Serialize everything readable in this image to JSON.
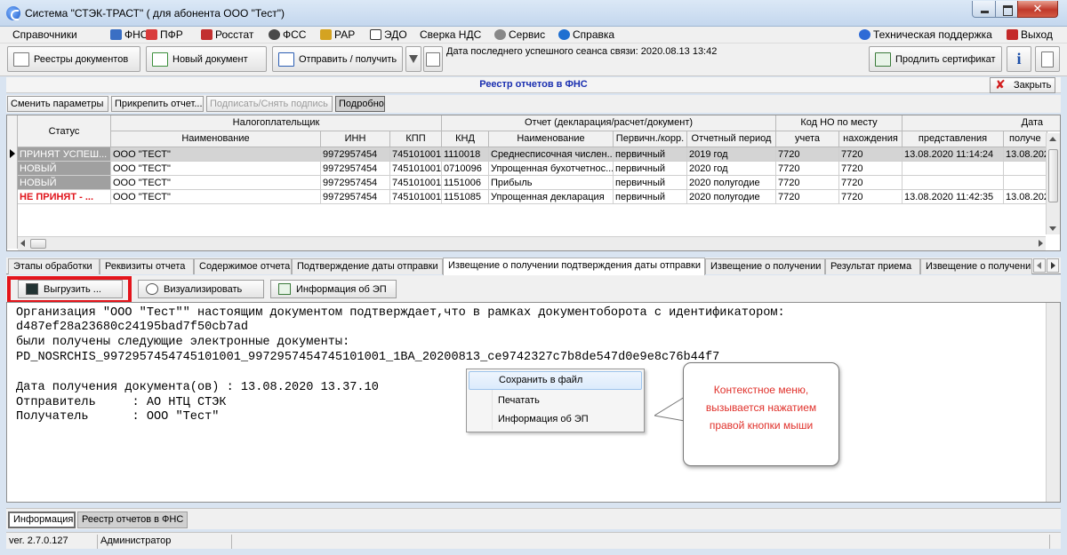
{
  "window": {
    "title": "Система \"СТЭК-ТРАСТ\" ( для абонента ООО \"Тест\")"
  },
  "menu": {
    "items": [
      "Справочники",
      "ФНС",
      "ПФР",
      "Росстат",
      "ФСС",
      "РАР",
      "ЭДО",
      "Сверка НДС",
      "Сервис",
      "Справка"
    ],
    "support": "Техническая поддержка",
    "exit": "Выход"
  },
  "toolbar": {
    "registry": "Реестры документов",
    "new_doc": "Новый документ",
    "send_receive": "Отправить / получить",
    "session": "Дата последнего успешного сеанса связи: 2020.08.13 13:42",
    "renew_cert": "Продлить сертификат"
  },
  "registry": {
    "title": "Реестр отчетов в ФНС",
    "close": "Закрыть"
  },
  "small_buttons": [
    "Сменить параметры",
    "Прикрепить отчет...",
    "Подписать/Снять подпись",
    "Подробно"
  ],
  "grid": {
    "group_headers": [
      "Налогоплательщик",
      "Отчет (декларация/расчет/документ)",
      "Код НО по месту",
      "Дата"
    ],
    "status_header": "Статус",
    "columns": [
      "Наименование",
      "ИНН",
      "КПП",
      "КНД",
      "Наименование",
      "Первичн./корр.",
      "Отчетный период",
      "учета",
      "нахождения",
      "представления",
      "получе"
    ],
    "rows": [
      {
        "status": "ПРИНЯТ УСПЕШ...",
        "cells": [
          "ООО \"ТЕСТ\"",
          "9972957454",
          "745101001",
          "1110018",
          "Среднесписочная числен...",
          "первичный",
          "2019 год",
          "7720",
          "7720",
          "13.08.2020 11:14:24",
          "13.08.202"
        ]
      },
      {
        "status": "НОВЫЙ",
        "cells": [
          "ООО \"ТЕСТ\"",
          "9972957454",
          "745101001",
          "0710096",
          "Упрощенная бухотчетнос...",
          "первичный",
          "2020 год",
          "7720",
          "7720",
          "",
          ""
        ]
      },
      {
        "status": "НОВЫЙ",
        "cells": [
          "ООО \"ТЕСТ\"",
          "9972957454",
          "745101001",
          "1151006",
          "Прибыль",
          "первичный",
          "2020 полугодие",
          "7720",
          "7720",
          "",
          ""
        ]
      },
      {
        "status": "НЕ ПРИНЯТ - ...",
        "cells": [
          "ООО \"ТЕСТ\"",
          "9972957454",
          "745101001",
          "1151085",
          "Упрощенная декларация",
          "первичный",
          "2020 полугодие",
          "7720",
          "7720",
          "13.08.2020 11:42:35",
          "13.08.202"
        ]
      }
    ]
  },
  "tabs": [
    "Этапы обработки",
    "Реквизиты отчета",
    "Содержимое отчета",
    "Подтверждение даты отправки",
    "Извещение о получении подтверждения даты отправки",
    "Извещение о получении",
    "Результат приема",
    "Извещение о получени"
  ],
  "actions": {
    "export": "Выгрузить ...",
    "visualize": "Визуализировать",
    "sig_info": "Информация об ЭП"
  },
  "document_lines": [
    "Организация \"ООО \"Тест\"\" настоящим документом подтверждает,что в рамках документоборота с идентификатором:",
    "d487ef28a23680c24195bad7f50cb7ad",
    "были получены следующие электронные документы:",
    "PD_NOSRCHIS_9972957454745101001_9972957454745101001_1BA_20200813_ce9742327c7b8de547d0e9e8c76b44f7",
    "",
    "Дата получения документа(ов) : 13.08.2020 13.37.10",
    "Отправитель     : АО НТЦ СТЭК",
    "Получатель      : ООО \"Тест\""
  ],
  "context_menu": [
    "Сохранить в файл",
    "Печатать",
    "Информация об ЭП"
  ],
  "callout": "Контекстное меню, вызывается нажатием правой кнопки мыши",
  "bottom_tabs": [
    "Информация",
    "Реестр отчетов в ФНС"
  ],
  "status": {
    "version": "ver. 2.7.0.127",
    "user": "Администратор"
  },
  "colors": {
    "accepted_bg": "#a0a0a0",
    "rejected_text": "#e0141b",
    "highlight": "#e4141b",
    "registry_title": "#1a2fb0"
  }
}
